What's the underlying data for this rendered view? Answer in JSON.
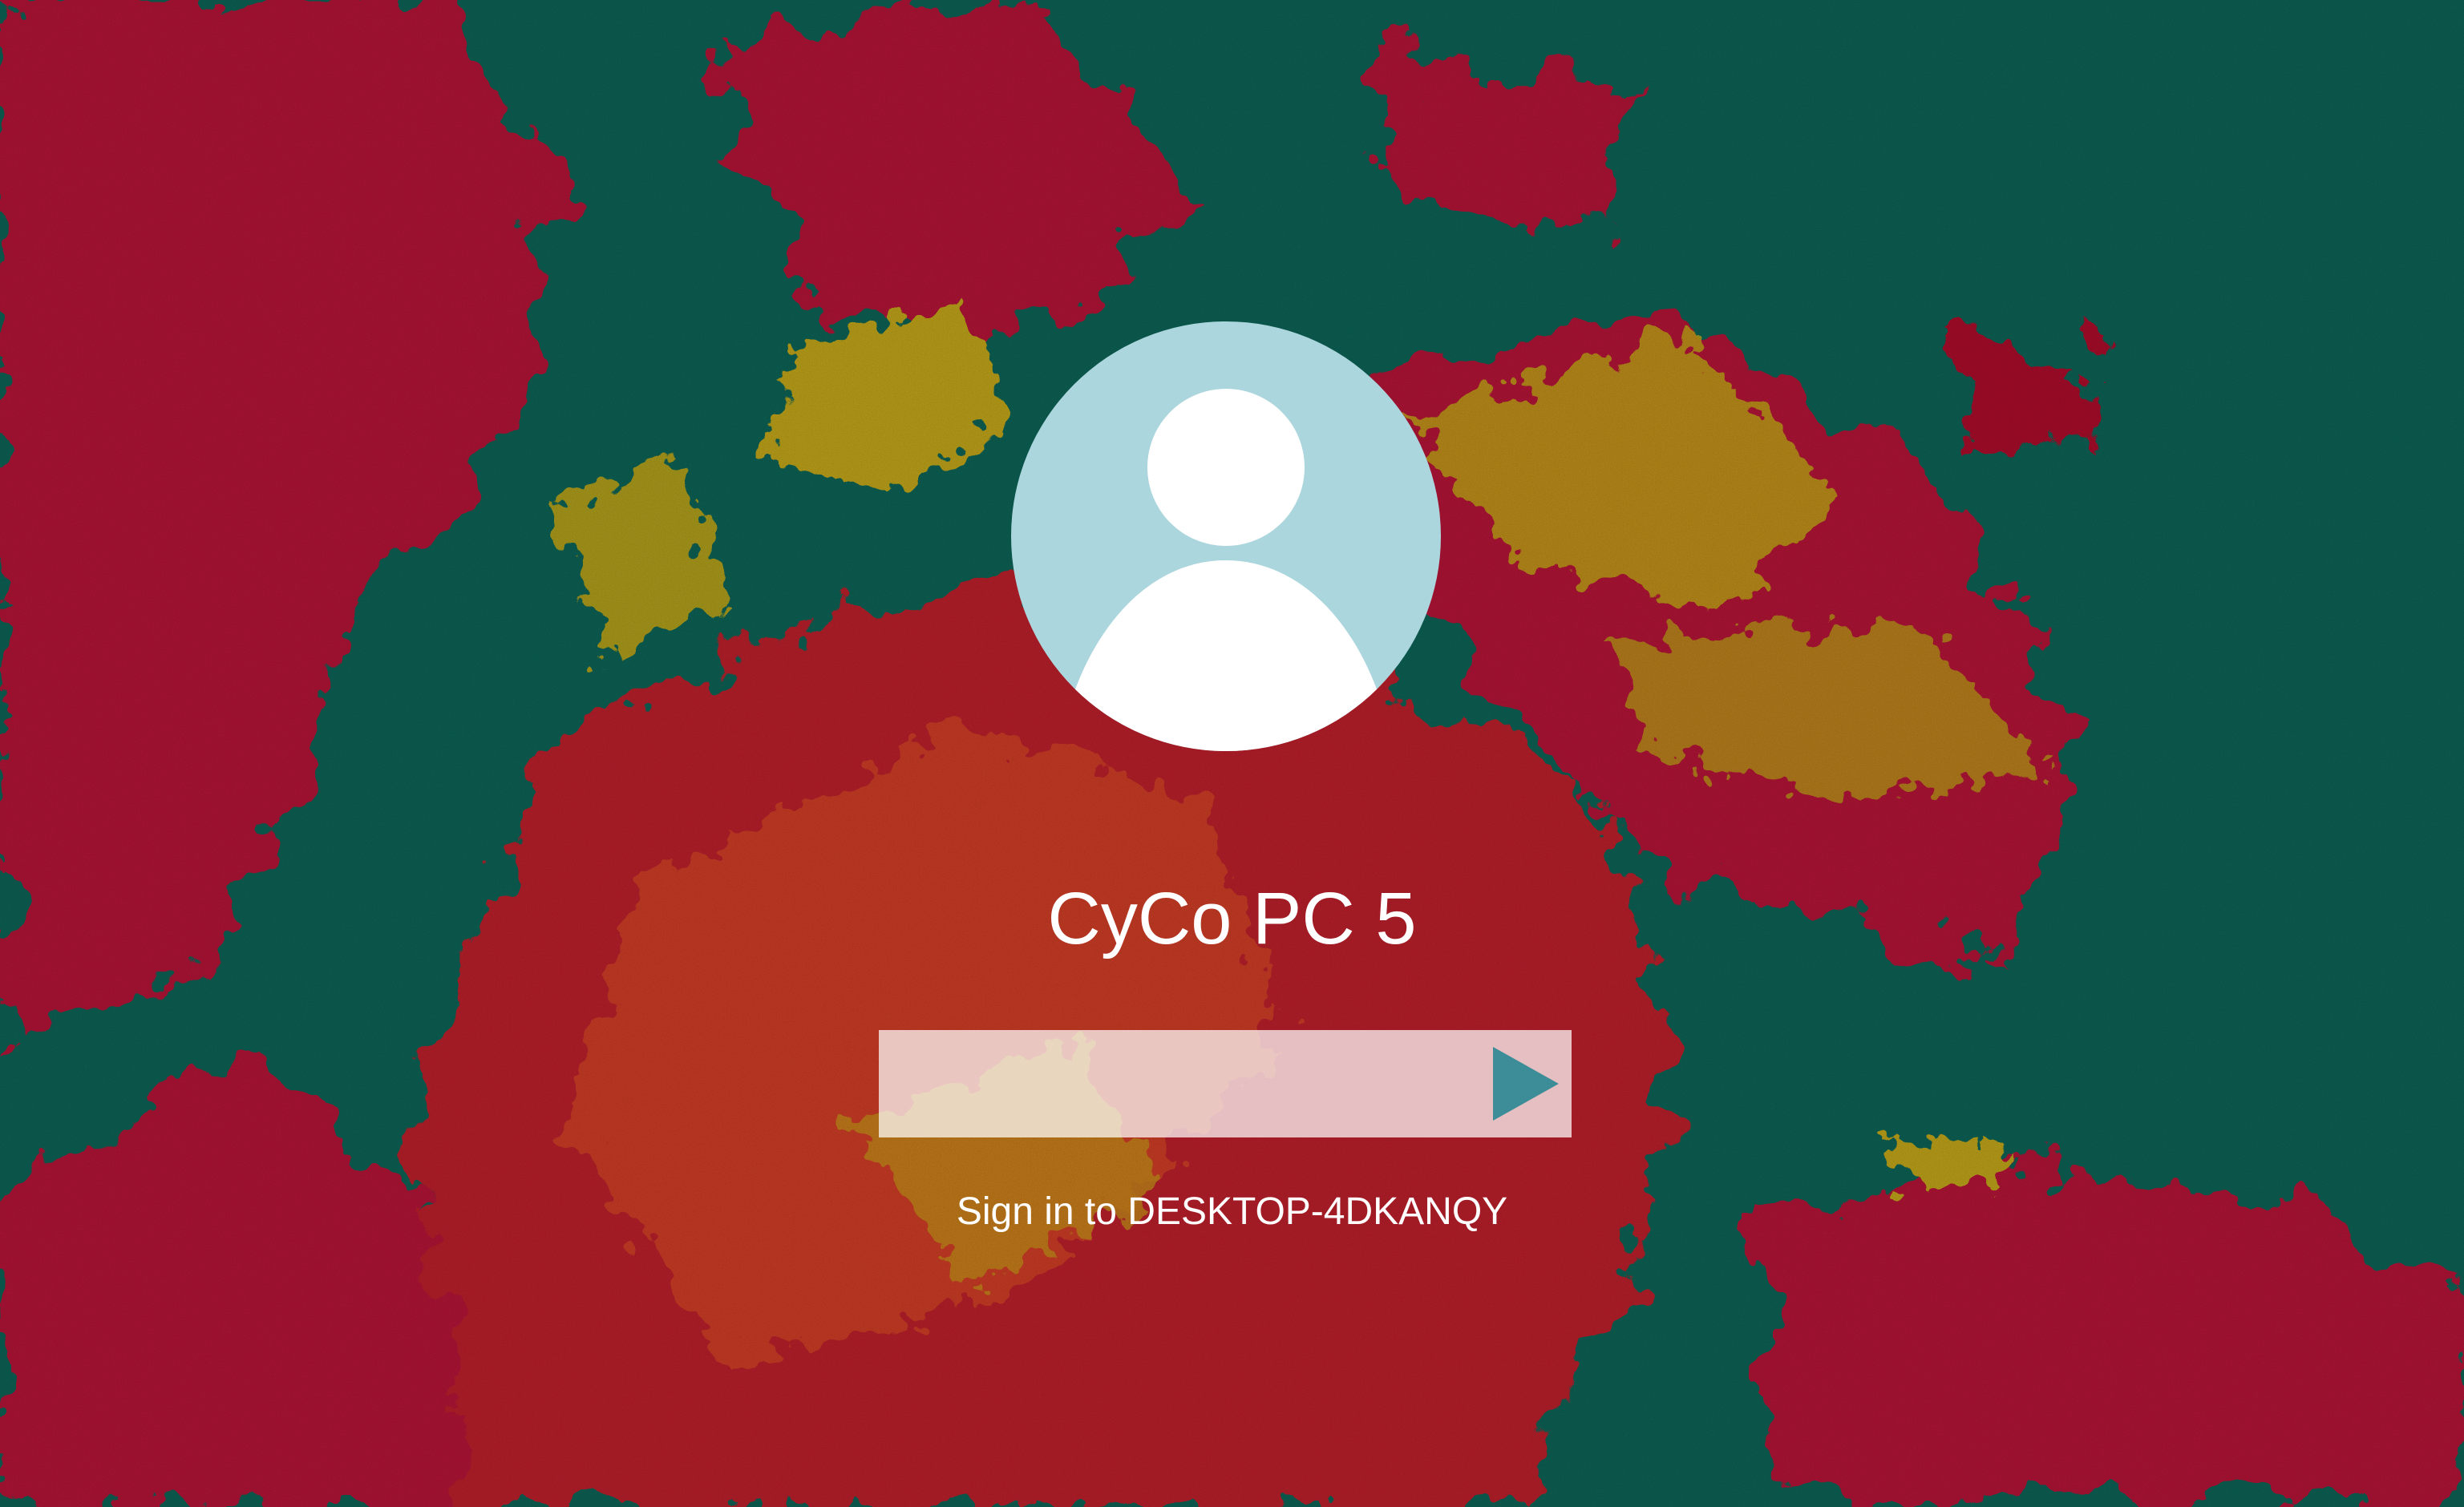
{
  "lock_screen": {
    "username": "CyCo PC 5",
    "password_value": "",
    "password_placeholder": "",
    "sign_in_text": "Sign in to DESKTOP-4DKANQY",
    "avatar_icon": "user-silhouette-icon",
    "submit_icon": "right-arrow-icon"
  },
  "colors": {
    "wallpaper_green": "#0e6a5c",
    "wallpaper_red": "#c1163a",
    "wallpaper_yellow": "#d0b21a",
    "wallpaper_orange": "#e0452a",
    "avatar_bg": "#acd6dd",
    "submit_arrow": "#3c8d98",
    "text": "#ffffff"
  }
}
